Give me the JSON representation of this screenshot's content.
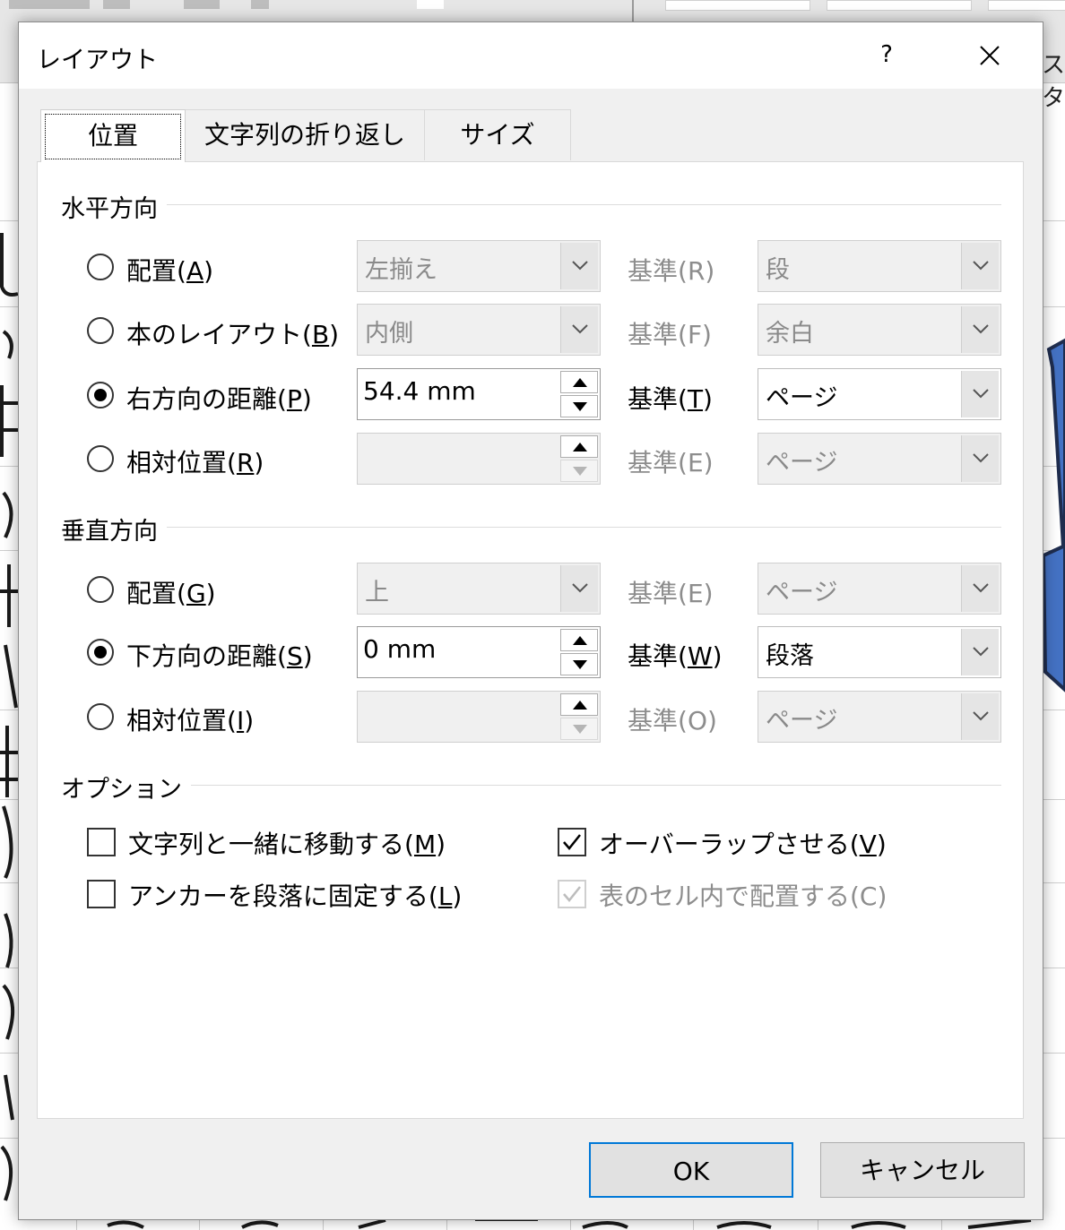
{
  "background": {
    "partial_tab_text": "スタ"
  },
  "dialog": {
    "title": "レイアウト",
    "help_label": "?",
    "tabs": [
      {
        "label": "位置"
      },
      {
        "label": "文字列の折り返し"
      },
      {
        "label": "サイズ"
      }
    ],
    "horizontal": {
      "heading": "水平方向",
      "rows": [
        {
          "label_pre": "配置(",
          "key": "A",
          "label_post": ")",
          "checked": false,
          "value": "左揃え",
          "kijun_pre": "基準(",
          "kijun_key": "R",
          "kijun_post": ")",
          "ref_value": "段"
        },
        {
          "label_pre": "本のレイアウト(",
          "key": "B",
          "label_post": ")",
          "checked": false,
          "value": "内側",
          "kijun_pre": "基準(",
          "kijun_key": "F",
          "kijun_post": ")",
          "ref_value": "余白"
        },
        {
          "label_pre": "右方向の距離(",
          "key": "P",
          "label_post": ")",
          "checked": true,
          "value": "54.4 mm",
          "kijun_pre": "基準(",
          "kijun_key": "T",
          "kijun_post": ")",
          "ref_value": "ページ"
        },
        {
          "label_pre": "相対位置(",
          "key": "R",
          "label_post": ")",
          "checked": false,
          "value": "",
          "kijun_pre": "基準(",
          "kijun_key": "E",
          "kijun_post": ")",
          "ref_value": "ページ"
        }
      ]
    },
    "vertical": {
      "heading": "垂直方向",
      "rows": [
        {
          "label_pre": "配置(",
          "key": "G",
          "label_post": ")",
          "checked": false,
          "value": "上",
          "kijun_pre": "基準(",
          "kijun_key": "E",
          "kijun_post": ")",
          "ref_value": "ページ"
        },
        {
          "label_pre": "下方向の距離(",
          "key": "S",
          "label_post": ")",
          "checked": true,
          "value": "0 mm",
          "kijun_pre": "基準(",
          "kijun_key": "W",
          "kijun_post": ")",
          "ref_value": "段落"
        },
        {
          "label_pre": "相対位置(",
          "key": "I",
          "label_post": ")",
          "checked": false,
          "value": "",
          "kijun_pre": "基準(",
          "kijun_key": "O",
          "kijun_post": ")",
          "ref_value": "ページ"
        }
      ]
    },
    "options": {
      "heading": "オプション",
      "items": [
        {
          "label_pre": "文字列と一緒に移動する(",
          "key": "M",
          "label_post": ")",
          "checked": false,
          "enabled": true
        },
        {
          "label_pre": "オーバーラップさせる(",
          "key": "V",
          "label_post": ")",
          "checked": true,
          "enabled": true
        },
        {
          "label_pre": "アンカーを段落に固定する(",
          "key": "L",
          "label_post": ")",
          "checked": false,
          "enabled": true
        },
        {
          "label_pre": "表のセル内で配置する(C)",
          "key": "",
          "label_post": "",
          "checked": true,
          "enabled": false
        }
      ]
    },
    "buttons": {
      "ok": "OK",
      "cancel": "キャンセル"
    }
  }
}
